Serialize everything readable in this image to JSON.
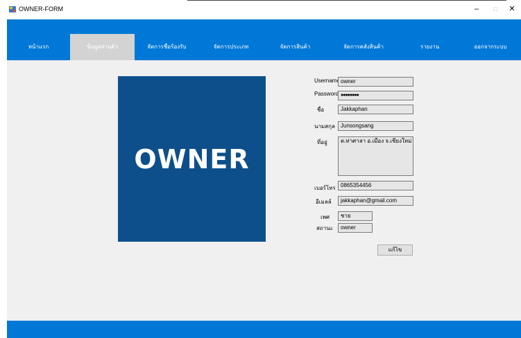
{
  "window": {
    "title": "OWNER-FORM",
    "controls": {
      "minimize": "–",
      "maximize": "□",
      "close": "✕"
    }
  },
  "colors": {
    "accent": "#0078d7",
    "logo_bg": "#0d4f8b",
    "active_tab": "#d3d3d3"
  },
  "nav": {
    "items": [
      {
        "label": "หน้าแรก",
        "active": false
      },
      {
        "label": "ข้อมูลส่วนตัว",
        "active": true
      },
      {
        "label": "จัดการชื่อร้องรับ",
        "active": false
      },
      {
        "label": "จัดการประเภท",
        "active": false
      },
      {
        "label": "จัดการสินค้า",
        "active": false
      },
      {
        "label": "จัดการคลังสินค้า",
        "active": false
      },
      {
        "label": "รายงาน",
        "active": false
      },
      {
        "label": "ออกจากระบบ",
        "active": false
      }
    ]
  },
  "logo": {
    "text": "OWNER"
  },
  "form": {
    "username": {
      "label": "Username",
      "value": "owner"
    },
    "password": {
      "label": "Password",
      "value": "●●●●●●●●"
    },
    "first_name": {
      "label": "ชื่อ",
      "value": "Jakkaphan"
    },
    "last_name": {
      "label": "นามสกุล",
      "value": "Junsongsang"
    },
    "address": {
      "label": "ที่อยู่",
      "value": "ต.ท่าศาลา อ.เมือง จ.เชียงใหม่"
    },
    "phone": {
      "label": "เบอร์โทร",
      "value": "0865354456"
    },
    "email": {
      "label": "อีเมลล์",
      "value": "jakkaphan@gmail.com"
    },
    "gender": {
      "label": "เพศ",
      "value": "ชาย"
    },
    "status": {
      "label": "สถานะ",
      "value": "owner"
    },
    "edit_button": "แก้ไข"
  }
}
